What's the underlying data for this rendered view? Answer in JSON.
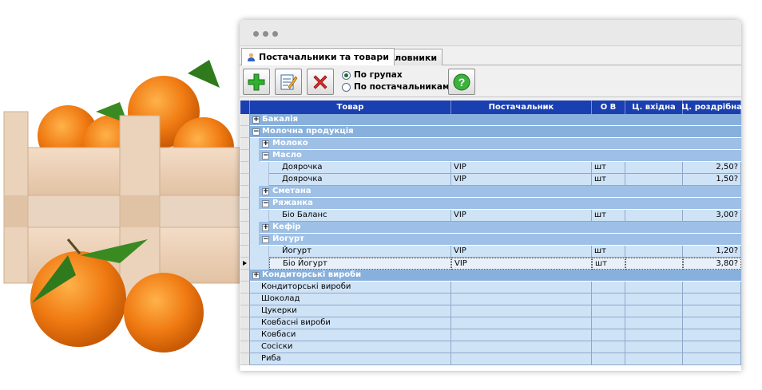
{
  "tabs": [
    {
      "label": "Постачальники та товари",
      "active": true
    },
    {
      "label": "Словники",
      "active": false
    }
  ],
  "toolbar": {
    "radio_groups": "По групах",
    "radio_suppliers": "По постачальникам",
    "selected_mode": "По групах"
  },
  "grid": {
    "columns": [
      "Товар",
      "Постачальник",
      "О В",
      "Ц. вхідна",
      "Ц. роздрібна"
    ],
    "groups": {
      "bakaliia": "Бакалія",
      "molochna": "Молочна продукція",
      "moloko": "Молоко",
      "maslo": "Масло",
      "smetana": "Сметана",
      "riazhanka": "Ряжанка",
      "kefir": "Кефір",
      "yohurt": "Йогурт",
      "kondyterski": "Кондиторські вироби"
    },
    "items": [
      {
        "name": "Доярочка",
        "supplier": "VIP",
        "unit": "шт",
        "price_in": "",
        "price_retail": "2,50?"
      },
      {
        "name": "Доярочка",
        "supplier": "VIP",
        "unit": "шт",
        "price_in": "",
        "price_retail": "1,50?"
      },
      {
        "name": "Біо Баланс",
        "supplier": "VIP",
        "unit": "шт",
        "price_in": "",
        "price_retail": "3,00?"
      },
      {
        "name": "Йогурт",
        "supplier": "VIP",
        "unit": "шт",
        "price_in": "",
        "price_retail": "1,20?"
      },
      {
        "name": "Біо Йогурт",
        "supplier": "VIP",
        "unit": "шт",
        "price_in": "",
        "price_retail": "3,80?"
      }
    ],
    "plain_rows": [
      "Кондиторські вироби",
      "Шоколад",
      "Цукерки",
      "Ковбасні вироби",
      "Ковбаси",
      "Сосіски",
      "Риба"
    ]
  },
  "colors": {
    "header": "#1a3fb0",
    "group_band": "#88b0dc",
    "cell": "#cfe3f7"
  }
}
